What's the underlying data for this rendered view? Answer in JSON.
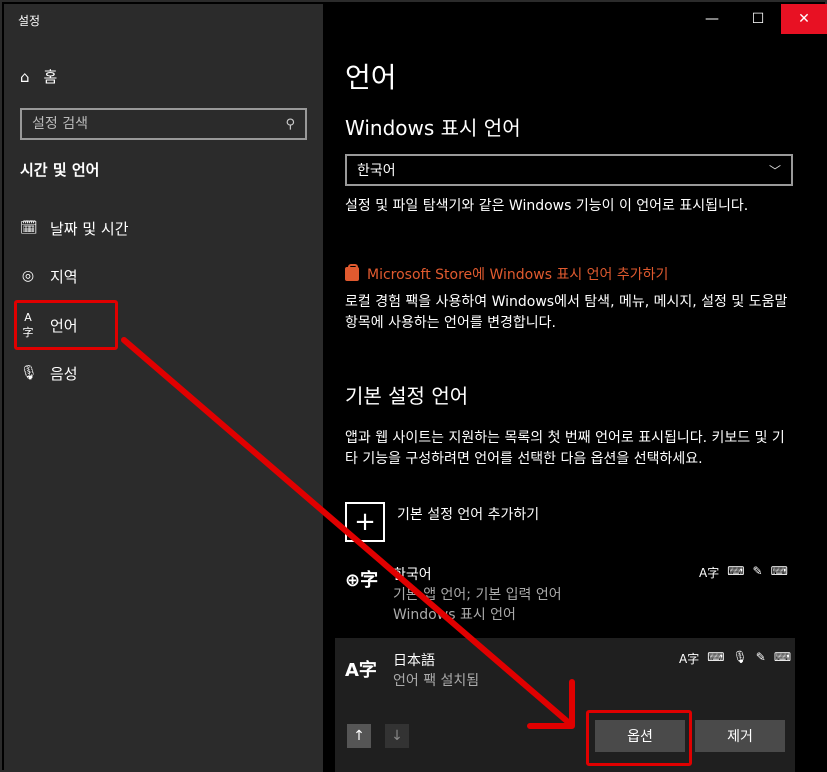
{
  "app": {
    "title": "설정"
  },
  "window_controls": {
    "minimize": "—",
    "maximize": "☐",
    "close": "✕"
  },
  "sidebar": {
    "home_label": "홈",
    "search_placeholder": "설정 검색",
    "section_title": "시간 및 언어",
    "items": [
      {
        "label": "날짜 및 시간",
        "icon": "calendar-clock-icon"
      },
      {
        "label": "지역",
        "icon": "region-globe-icon"
      },
      {
        "label": "언어",
        "icon": "language-icon"
      },
      {
        "label": "음성",
        "icon": "microphone-icon"
      }
    ]
  },
  "main": {
    "page_title": "언어",
    "display_heading": "Windows 표시 언어",
    "display_dropdown_value": "한국어",
    "display_desc": "설정 및 파일 탐색기와 같은 Windows 기능이 이 언어로 표시됩니다.",
    "store_link": "Microsoft Store에 Windows 표시 언어 추가하기",
    "store_desc": "로컬 경험 팩을 사용하여 Windows에서 탐색, 메뉴, 메시지, 설정 및 도움말 항목에 사용하는 언어를 변경합니다.",
    "pref_heading": "기본 설정 언어",
    "pref_desc": "앱과 웹 사이트는 지원하는 목록의 첫 번째 언어로 표시됩니다. 키보드 및 기타 기능을 구성하려면 언어를 선택한 다음 옵션을 선택하세요.",
    "add_language": "기본 설정 언어 추가하기",
    "languages": [
      {
        "name": "한국어",
        "sub1": "기본 앱 언어; 기본 입력 언어",
        "sub2": "Windows 표시 언어"
      },
      {
        "name": "日本語",
        "sub1": "언어 팩 설치됨"
      }
    ],
    "options_button": "옵션",
    "remove_button": "제거"
  },
  "colors": {
    "accent_link": "#e05a2f",
    "annotation": "#e00000",
    "close_button": "#e81123"
  }
}
